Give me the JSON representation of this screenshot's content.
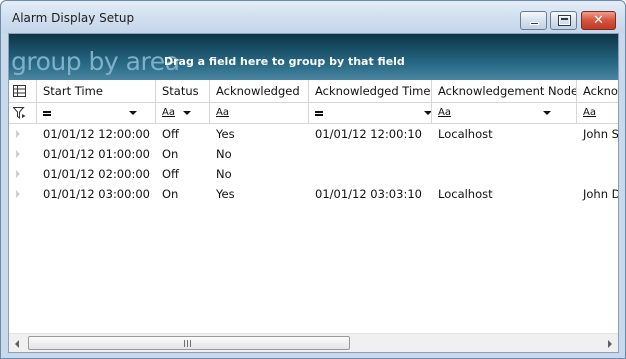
{
  "window": {
    "title": "Alarm Display Setup",
    "controls": {
      "minimize_icon": "minimize-icon",
      "maximize_icon": "maximize-icon",
      "close_icon": "close-icon",
      "close_glyph": "✕"
    }
  },
  "groupbar": {
    "title": "group by area",
    "hint": "Drag a field here to group by that field",
    "colors": {
      "top": "#0f3446",
      "bottom": "#4a86a1",
      "title": "#7fb0c8"
    }
  },
  "grid": {
    "corner_icon": "column-chooser-icon",
    "filter_icon": "filter-icon",
    "columns": [
      {
        "key": "start_time",
        "label": "Start Time",
        "filter_op": "=",
        "filter_type": "equals"
      },
      {
        "key": "status",
        "label": "Status",
        "filter_op": "Aa",
        "filter_type": "text"
      },
      {
        "key": "acknowledged",
        "label": "Acknowledged",
        "filter_op": "Aa",
        "filter_type": "text"
      },
      {
        "key": "ack_time",
        "label": "Acknowledged Time",
        "filter_op": "=",
        "filter_type": "equals"
      },
      {
        "key": "ack_node",
        "label": "Acknowledgement Node",
        "filter_op": "Aa",
        "filter_type": "text"
      },
      {
        "key": "ack_user",
        "label": "Acknow",
        "filter_op": "Aa",
        "filter_type": "text"
      }
    ],
    "rows": [
      {
        "start_time": "01/01/12 12:00:00",
        "status": "Off",
        "acknowledged": "Yes",
        "ack_time": "01/01/12 12:00:10",
        "ack_node": "Localhost",
        "ack_user": "John Sm"
      },
      {
        "start_time": "01/01/12 01:00:00",
        "status": "On",
        "acknowledged": "No",
        "ack_time": "",
        "ack_node": "",
        "ack_user": ""
      },
      {
        "start_time": "01/01/12 02:00:00",
        "status": "Off",
        "acknowledged": "No",
        "ack_time": "",
        "ack_node": "",
        "ack_user": ""
      },
      {
        "start_time": "01/01/12 03:00:00",
        "status": "On",
        "acknowledged": "Yes",
        "ack_time": "01/01/12 03:03:10",
        "ack_node": "Localhost",
        "ack_user": "John Do"
      }
    ]
  },
  "scrollbar": {
    "left_icon": "scroll-left-icon",
    "right_icon": "scroll-right-icon",
    "grip_icon": "thumb-grip-icon"
  }
}
